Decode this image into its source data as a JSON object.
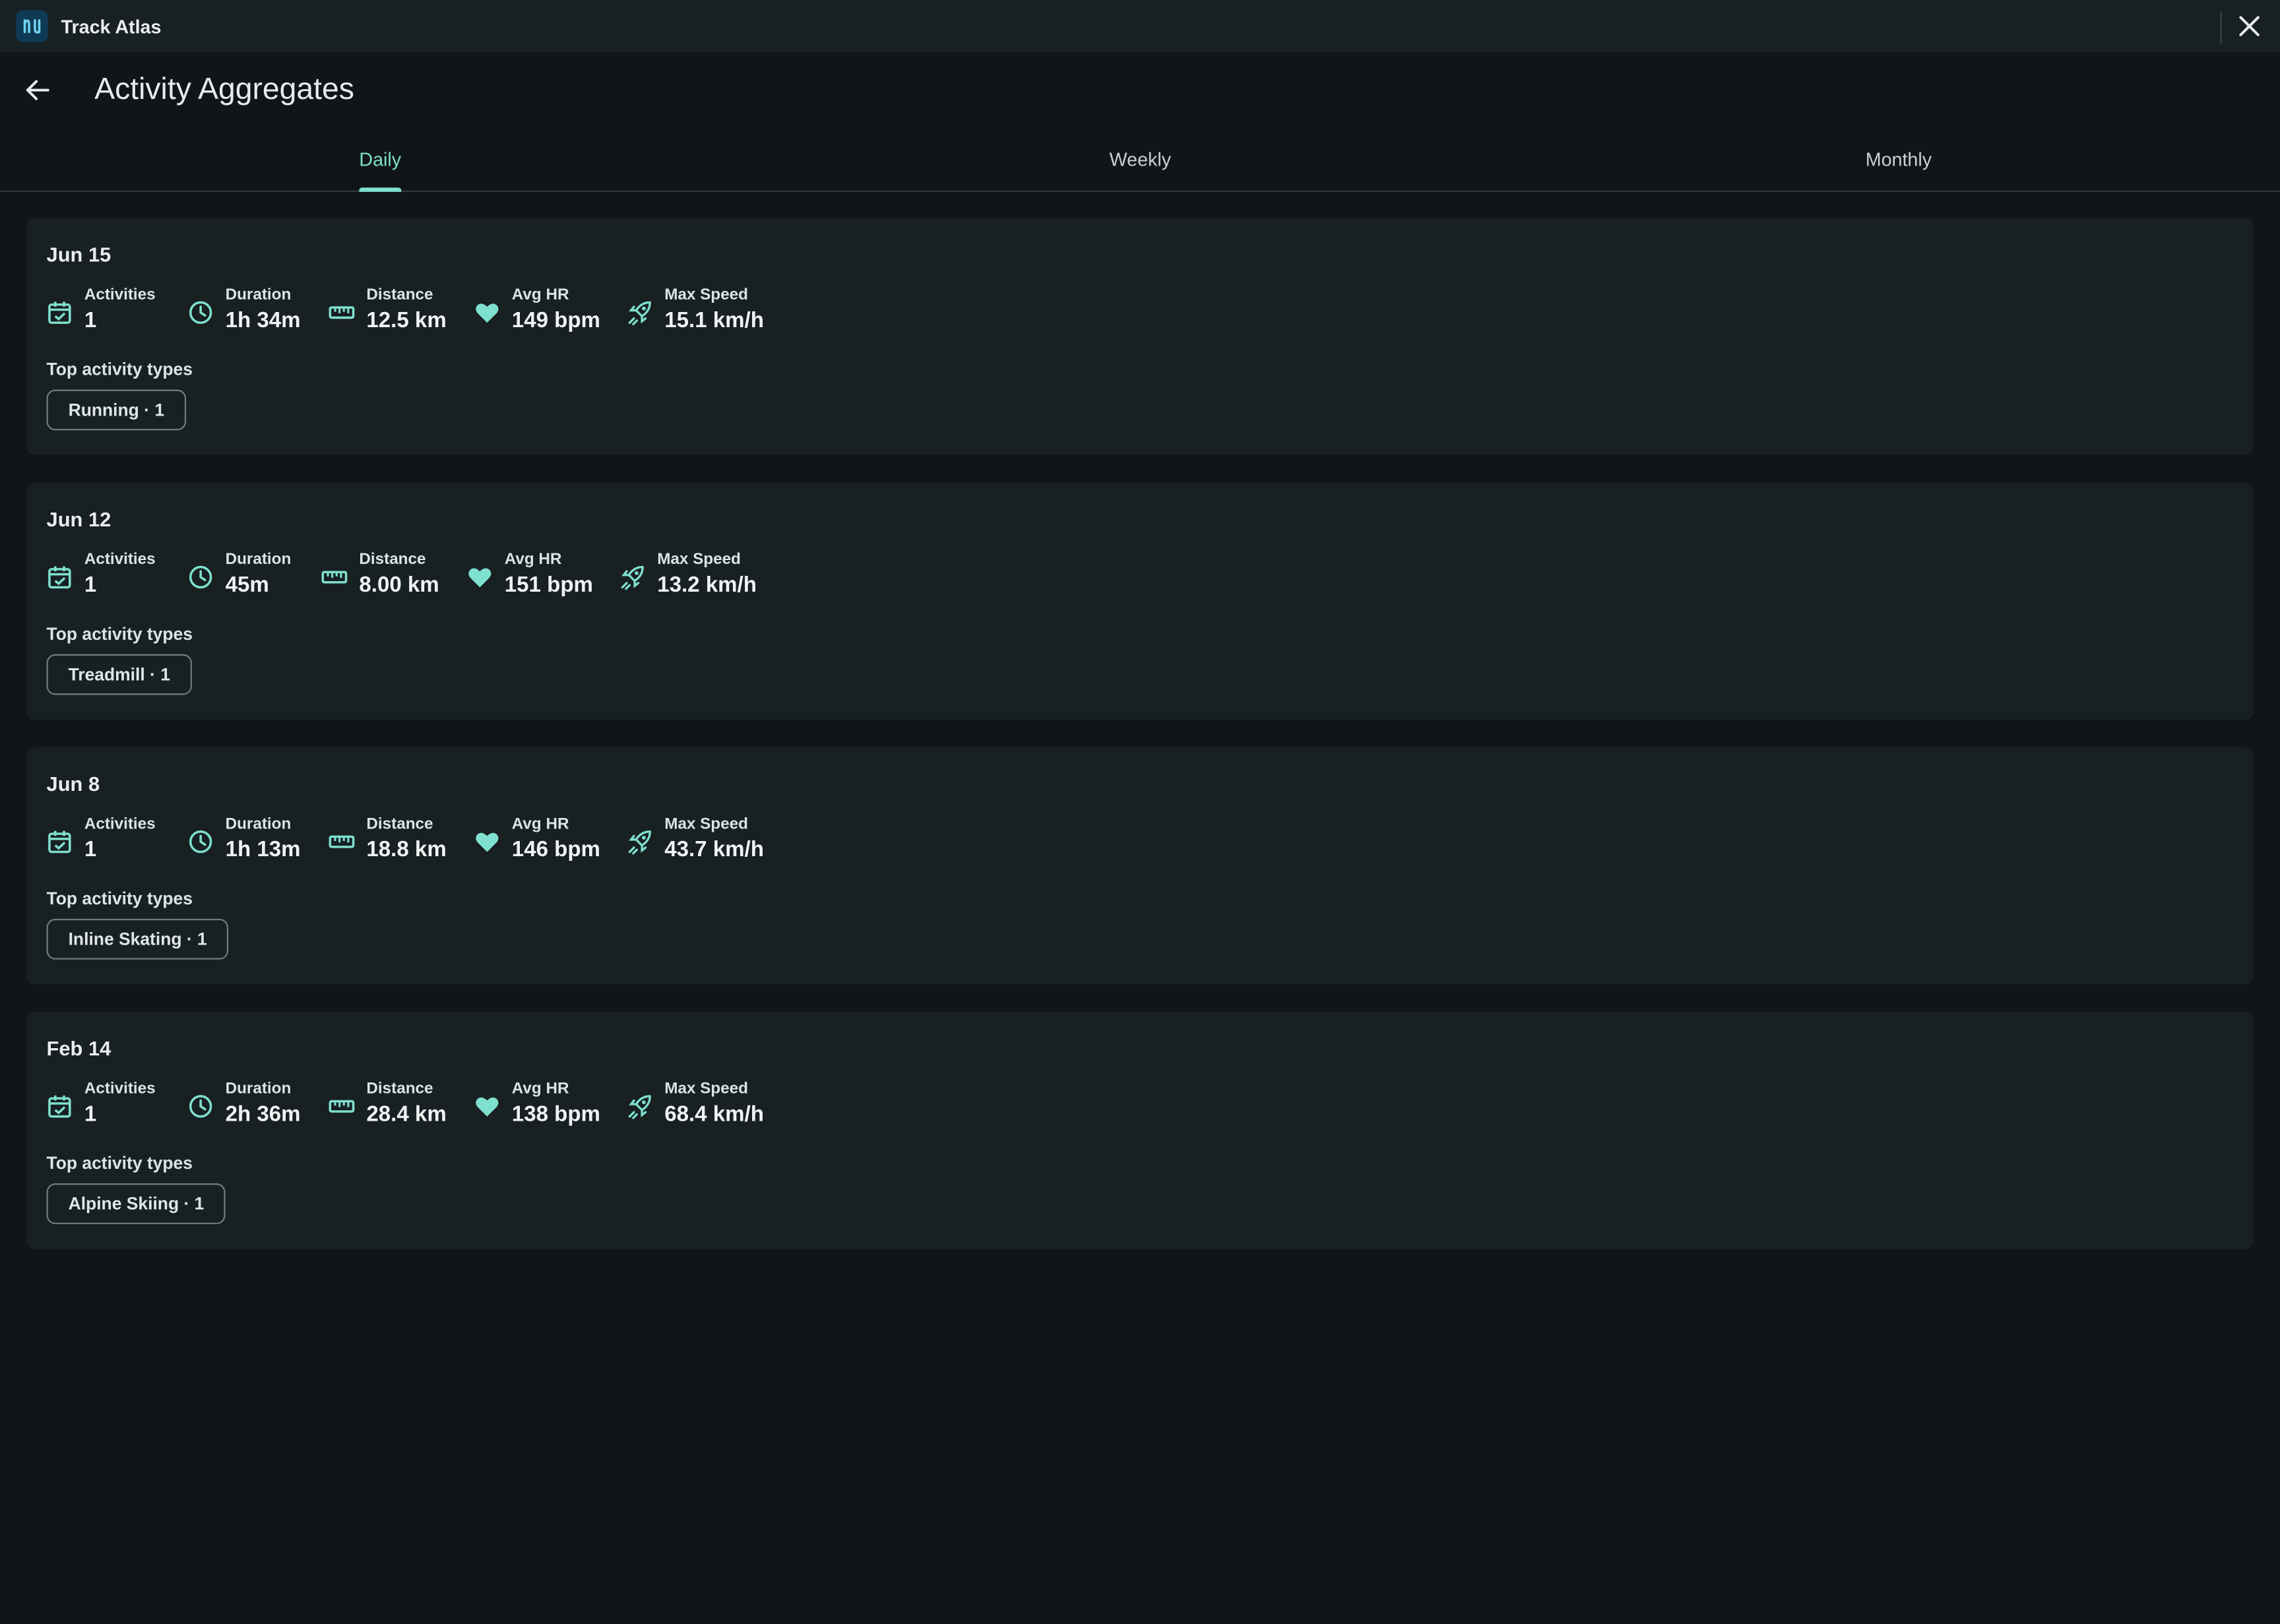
{
  "app": {
    "name": "Track Atlas"
  },
  "header": {
    "title": "Activity Aggregates"
  },
  "tabs": [
    {
      "label": "Daily",
      "active": true
    },
    {
      "label": "Weekly",
      "active": false
    },
    {
      "label": "Monthly",
      "active": false
    }
  ],
  "metric_labels": {
    "activities": "Activities",
    "duration": "Duration",
    "distance": "Distance",
    "avg_hr": "Avg HR",
    "max_speed": "Max Speed"
  },
  "section_label": "Top activity types",
  "icons": {
    "activities": "calendar-check-icon",
    "duration": "clock-icon",
    "distance": "ruler-icon",
    "avg_hr": "heart-icon",
    "max_speed": "rocket-icon",
    "back": "arrow-left-icon",
    "close": "close-icon"
  },
  "colors": {
    "accent": "#7fe0cf",
    "background": "#101617",
    "card": "#182022"
  },
  "days": [
    {
      "date": "Jun 15",
      "activities": "1",
      "duration": "1h 34m",
      "distance": "12.5 km",
      "avg_hr": "149 bpm",
      "max_speed": "15.1 km/h",
      "top_type": "Running · 1"
    },
    {
      "date": "Jun 12",
      "activities": "1",
      "duration": "45m",
      "distance": "8.00 km",
      "avg_hr": "151 bpm",
      "max_speed": "13.2 km/h",
      "top_type": "Treadmill · 1"
    },
    {
      "date": "Jun 8",
      "activities": "1",
      "duration": "1h 13m",
      "distance": "18.8 km",
      "avg_hr": "146 bpm",
      "max_speed": "43.7 km/h",
      "top_type": "Inline Skating · 1"
    },
    {
      "date": "Feb 14",
      "activities": "1",
      "duration": "2h 36m",
      "distance": "28.4 km",
      "avg_hr": "138 bpm",
      "max_speed": "68.4 km/h",
      "top_type": "Alpine Skiing · 1"
    }
  ]
}
